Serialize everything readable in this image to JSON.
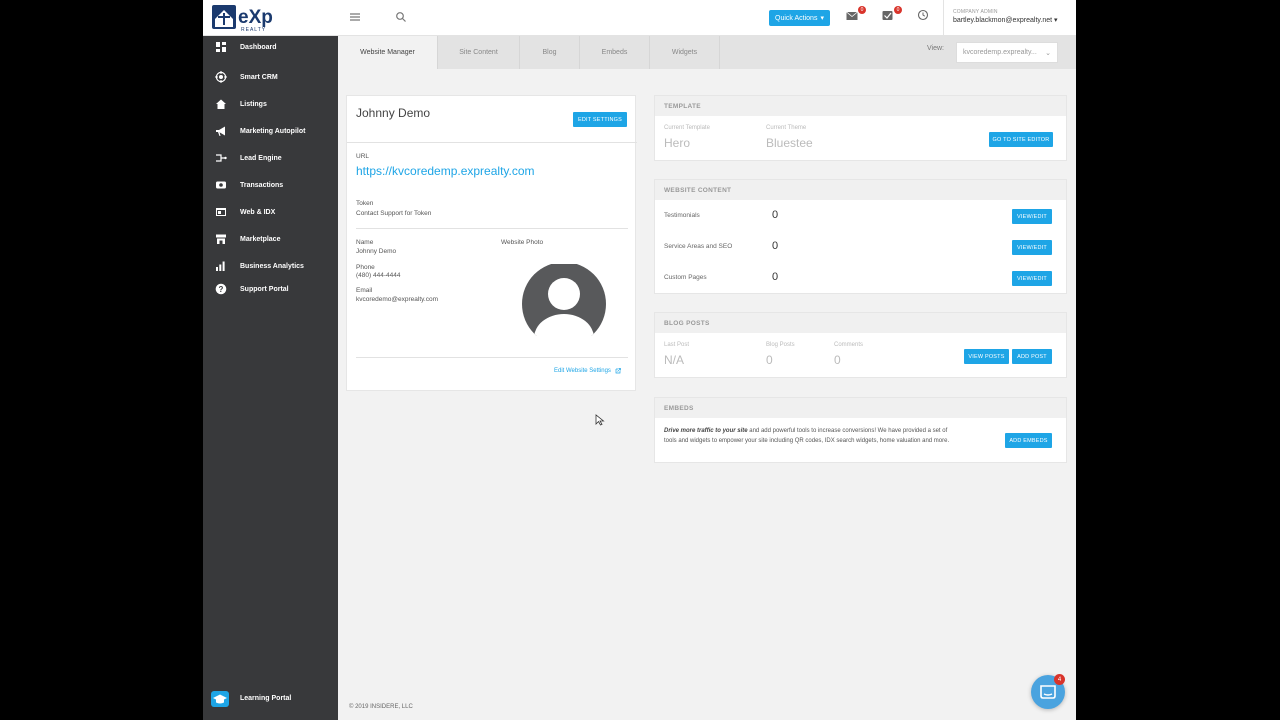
{
  "header": {
    "logo_text": "eXp",
    "logo_sub": "REALTY",
    "quick_actions_label": "Quick Actions",
    "notifications_count": "0",
    "tasks_count": "0",
    "company_admin_label": "COMPANY ADMIN",
    "account_email": "bartley.blackmon@exprealty.net"
  },
  "sidebar": {
    "items": [
      {
        "label": "Dashboard",
        "icon": "dashboard-icon"
      },
      {
        "label": "Smart CRM",
        "icon": "crm-icon"
      },
      {
        "label": "Listings",
        "icon": "home-icon"
      },
      {
        "label": "Marketing Autopilot",
        "icon": "megaphone-icon"
      },
      {
        "label": "Lead Engine",
        "icon": "lead-engine-icon"
      },
      {
        "label": "Transactions",
        "icon": "transactions-icon"
      },
      {
        "label": "Web & IDX",
        "icon": "web-icon"
      },
      {
        "label": "Marketplace",
        "icon": "marketplace-icon"
      },
      {
        "label": "Business Analytics",
        "icon": "analytics-icon"
      },
      {
        "label": "Support Portal",
        "icon": "help-icon"
      }
    ],
    "learning_portal_label": "Learning Portal"
  },
  "tabs": {
    "items": [
      "Website Manager",
      "Site Content",
      "Blog",
      "Embeds",
      "Widgets"
    ],
    "active": "Website Manager",
    "view_label": "View:",
    "view_selected": "kvcoredemp.exprealty..."
  },
  "profile_card": {
    "name": "Johnny Demo",
    "edit_settings_label": "EDIT SETTINGS",
    "url_label": "URL",
    "url_value": "https://kvcoredemp.exprealty.com",
    "token_label": "Token",
    "token_value": "Contact Support for Token",
    "name_label": "Name",
    "name_value": "Johnny Demo",
    "phone_label": "Phone",
    "phone_value": "(480) 444-4444",
    "email_label": "Email",
    "email_value": "kvcoredemo@exprealty.com",
    "photo_label": "Website Photo",
    "edit_website_settings_link": "Edit Website Settings"
  },
  "template_card": {
    "title": "TEMPLATE",
    "current_template_label": "Current Template",
    "current_template_value": "Hero",
    "current_theme_label": "Current Theme",
    "current_theme_value": "Bluestee",
    "go_to_editor_label": "GO TO SITE EDITOR"
  },
  "website_content_card": {
    "title": "WEBSITE CONTENT",
    "rows": [
      {
        "label": "Testimonials",
        "count": "0",
        "button": "VIEW/EDIT"
      },
      {
        "label": "Service Areas and SEO",
        "count": "0",
        "button": "VIEW/EDIT"
      },
      {
        "label": "Custom Pages",
        "count": "0",
        "button": "VIEW/EDIT"
      }
    ]
  },
  "blog_card": {
    "title": "BLOG POSTS",
    "last_post_label": "Last Post",
    "last_post_value": "N/A",
    "blog_posts_label": "Blog Posts",
    "blog_posts_value": "0",
    "comments_label": "Comments",
    "comments_value": "0",
    "view_posts_label": "VIEW POSTS",
    "add_post_label": "ADD POST"
  },
  "embeds_card": {
    "title": "EMBEDS",
    "description_lead": "Drive more traffic to your site",
    "description_line1": " and add powerful tools to increase conversions! We have provided a set of",
    "description_line2": "tools and widgets to empower your site including QR codes, IDX search widgets, home valuation and more.",
    "add_embeds_label": "ADD EMBEDS"
  },
  "footer": {
    "copyright": "© 2019 INSIDERE, LLC",
    "chat_badge": "4"
  },
  "colors": {
    "accent": "#1ea5e6",
    "sidebar_bg": "#38393b",
    "badge_red": "#d9342b"
  }
}
